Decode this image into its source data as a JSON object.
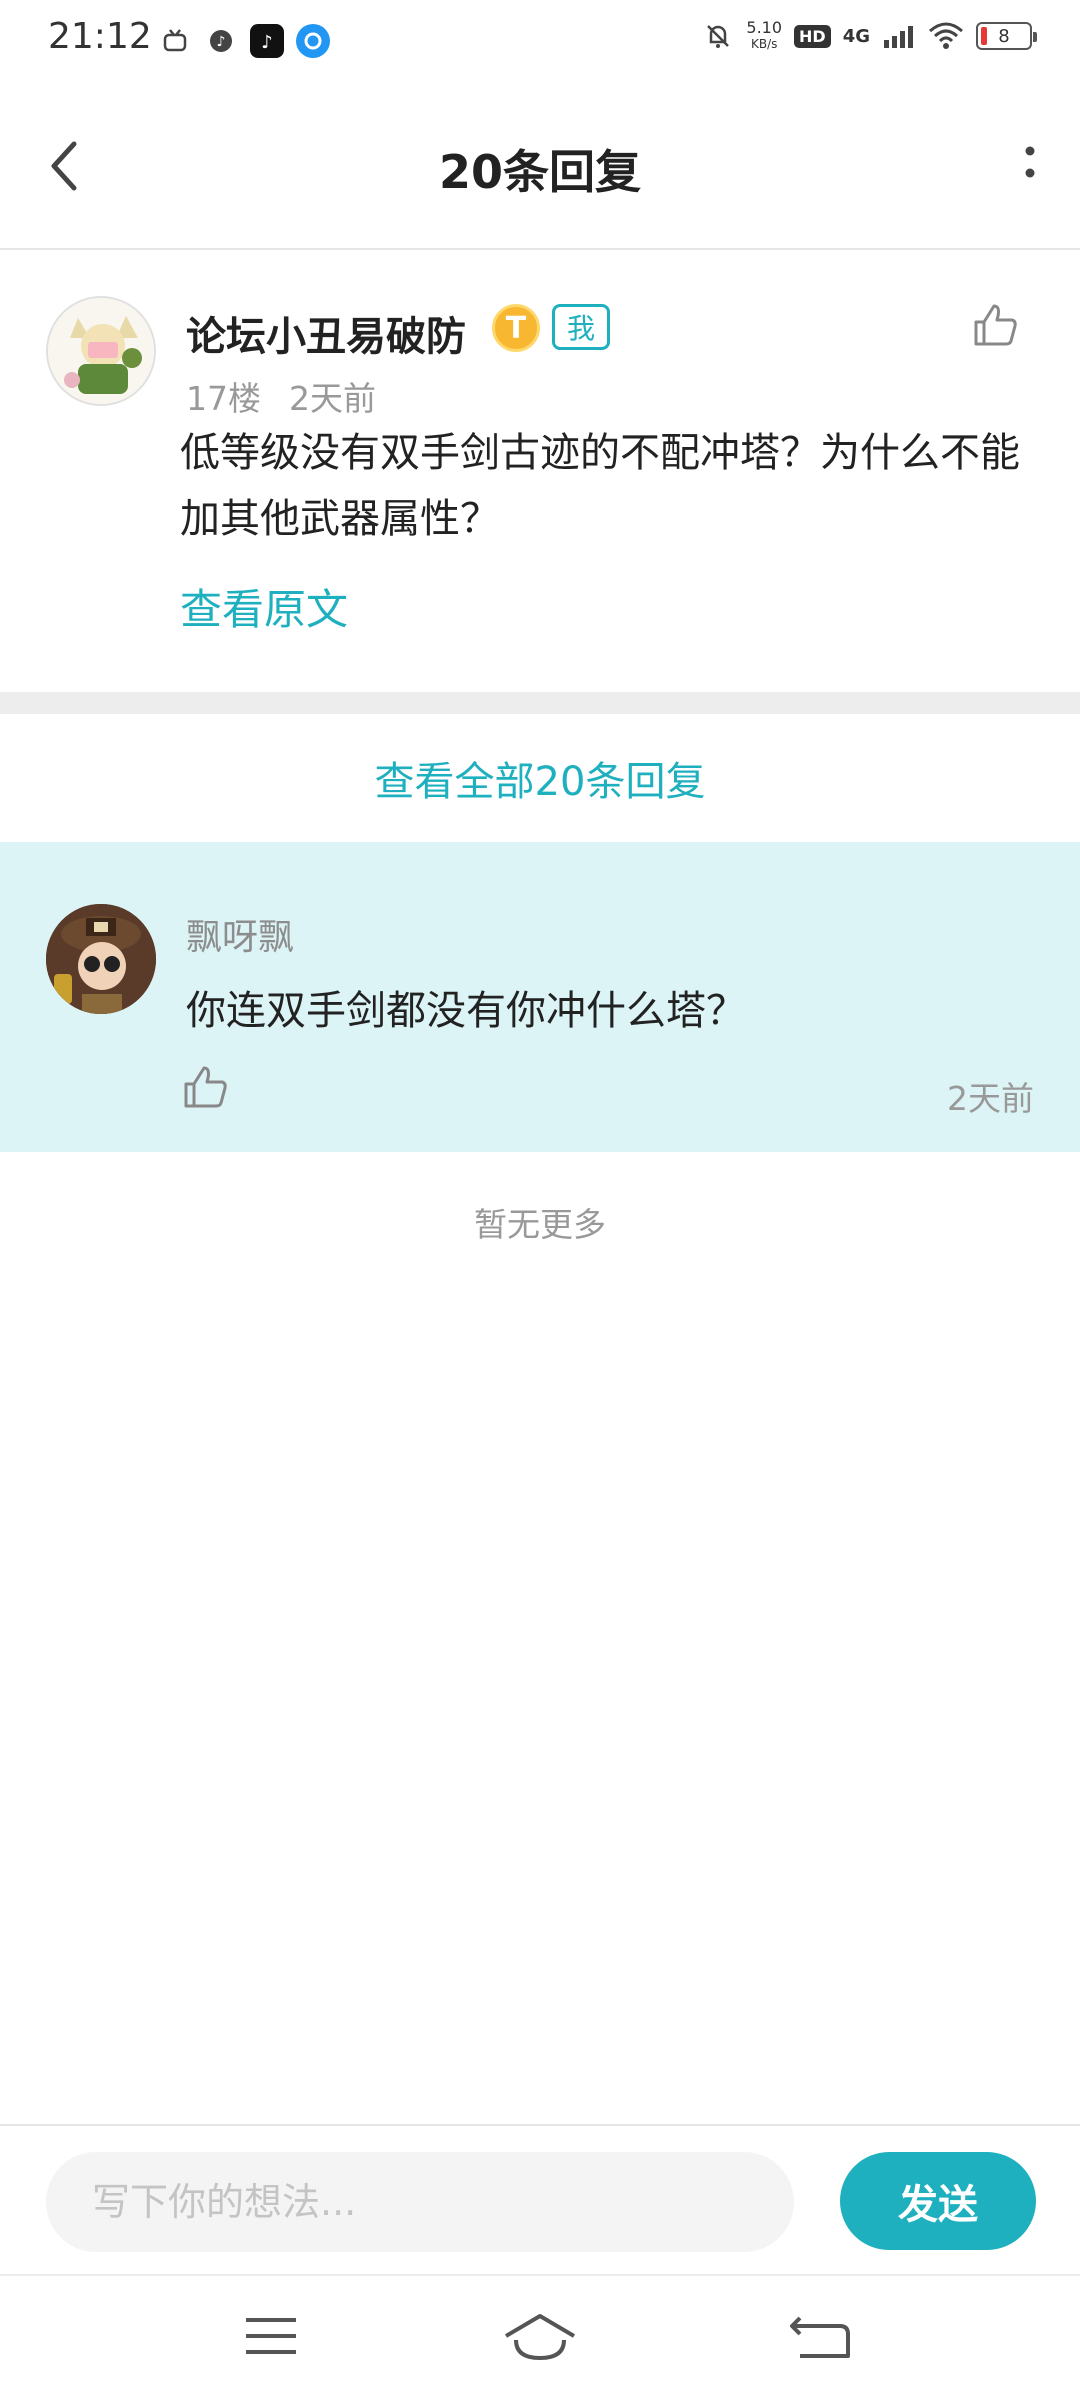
{
  "status_bar": {
    "time": "21:12",
    "speed_value": "5.10",
    "speed_unit": "KB/s",
    "hd": "HD",
    "network": "4G",
    "battery": "8"
  },
  "header": {
    "title": "20条回复"
  },
  "post": {
    "username": "论坛小丑易破防",
    "level_badge": "T",
    "self_badge": "我",
    "floor": "17楼",
    "time": "2天前",
    "content": "低等级没有双手剑古迹的不配冲塔？为什么不能加其他武器属性？",
    "view_original": "查看原文"
  },
  "view_all_label": "查看全部20条回复",
  "reply": {
    "username": "飘呀飘",
    "content": "你连双手剑都没有你冲什么塔？",
    "time": "2天前"
  },
  "no_more": "暂无更多",
  "input": {
    "placeholder": "写下你的想法...",
    "send_label": "发送"
  },
  "colors": {
    "accent": "#1fb0bf",
    "reply_bg": "#dcf4f6"
  }
}
